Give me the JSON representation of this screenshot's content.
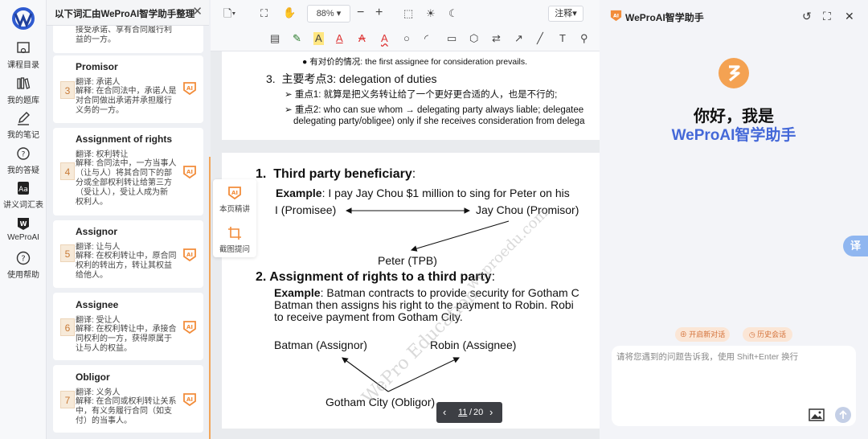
{
  "nav": {
    "items": [
      {
        "label": "课程目录",
        "icon": "course-catalog-icon"
      },
      {
        "label": "我的题库",
        "icon": "question-bank-icon"
      },
      {
        "label": "我的笔记",
        "icon": "notes-pen-icon"
      },
      {
        "label": "我的答疑",
        "icon": "qa-icon"
      },
      {
        "label": "讲义词汇表",
        "icon": "glossary-icon"
      },
      {
        "label": "WeProAI",
        "icon": "weproai-icon"
      },
      {
        "label": "使用帮助",
        "icon": "help-icon"
      }
    ]
  },
  "term_panel": {
    "title": "以下词汇由WeProAI智学助手整理",
    "partial_text": [
      "接受承诺、享有合同履行利",
      "益的一方。"
    ],
    "cards": [
      {
        "num": "3",
        "term": "Promisor",
        "translation": "翻译: 承诺人",
        "explanation": [
          "解释: 在合同法中，承诺人是",
          "对合同做出承诺并承担履行",
          "义务的一方。"
        ]
      },
      {
        "num": "4",
        "term": "Assignment of rights",
        "translation": "翻译: 权利转让",
        "explanation": [
          "解释: 合同法中，一方当事人",
          "（让与人）将其合同下的部",
          "分或全部权利转让给第三方",
          "（受让人），受让人成为新",
          "权利人。"
        ]
      },
      {
        "num": "5",
        "term": "Assignor",
        "translation": "翻译: 让与人",
        "explanation": [
          "解释: 在权利转让中，原合同",
          "权利的转出方，转让其权益",
          "给他人。"
        ]
      },
      {
        "num": "6",
        "term": "Assignee",
        "translation": "翻译: 受让人",
        "explanation": [
          "解释: 在权利转让中，承接合",
          "同权利的一方，获得原属于",
          "让与人的权益。"
        ]
      },
      {
        "num": "7",
        "term": "Obligor",
        "translation": "翻译: 义务人",
        "explanation": [
          "解释: 在合同或权利转让关系",
          "中，有义务履行合同（如支",
          "付）的当事人。"
        ]
      }
    ]
  },
  "toolbar": {
    "zoom": "88%",
    "annotation_label": "注释"
  },
  "doc": {
    "page1": {
      "bullet_label": "有对价的情况:",
      "bullet_text": "the first assignee for consideration prevails.",
      "heading_num": "3.",
      "heading_cn": "主要考点3:",
      "heading_en": "delegation of duties",
      "point1_label": "重点1:",
      "point1_text": "就算是把义务转让给了一个更好更合适的人，也是不行的;",
      "point2_label": "重点2:",
      "point2_text": "who can sue whom → delegating party always liable; delegatee",
      "point2_cont": "delegating party/obligee) only if she receives consideration from delega"
    },
    "page2": {
      "s1_num": "1.",
      "s1_title": "Third party beneficiary",
      "s1_colon": ":",
      "s1_example_label": "Example",
      "s1_example_text": ": I pay Jay Chou $1 million to sing for Peter on his",
      "promisee": "I (Promisee)",
      "promisor": "Jay Chou (Promisor)",
      "tpb": "Peter (TPB)",
      "s2_num": "2.",
      "s2_title": "Assignment of rights to a third party",
      "s2_colon": ":",
      "s2_example_label": "Example",
      "s2_line1": ": Batman contracts to provide security for Gotham C",
      "s2_line2": "Batman then assigns his right to the payment to Robin. Robi",
      "s2_line3": "to receive payment from Gotham City.",
      "assignor": "Batman (Assignor)",
      "assignee": "Robin (Assignee)",
      "obligor": "Gotham City (Obligor)",
      "watermark1": "WePro Education",
      "watermark2": "weproedu.com"
    }
  },
  "float_tools": {
    "page_summary": "本页精讲",
    "screenshot_ask": "截图提问"
  },
  "page_nav": {
    "current": "11",
    "total": "20"
  },
  "assistant": {
    "title": "WeProAI智学助手",
    "greeting": "你好，我是",
    "name": "WeProAI智学助手",
    "new_chat": "开启新对话",
    "history": "历史会话",
    "input_placeholder": "请将您遇到的问题告诉我，使用 Shift+Enter 换行",
    "translate_tab": "译"
  },
  "colors": {
    "accent_orange": "#F28C3A",
    "brand_blue": "#4468D8"
  }
}
